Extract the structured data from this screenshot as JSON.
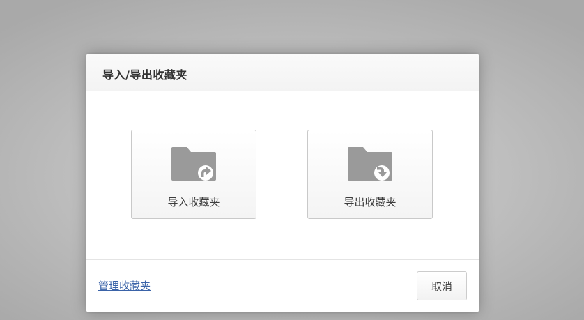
{
  "dialog": {
    "title": "导入/导出收藏夹",
    "import_card": {
      "label": "导入收藏夹",
      "icon": "folder-upload-icon"
    },
    "export_card": {
      "label": "导出收藏夹",
      "icon": "folder-download-icon"
    },
    "footer": {
      "manage_link": "管理收藏夹",
      "cancel_label": "取消"
    }
  },
  "colors": {
    "icon_gray": "#9a9a9a",
    "link_blue": "#3a63a8",
    "title_text": "#333333"
  }
}
